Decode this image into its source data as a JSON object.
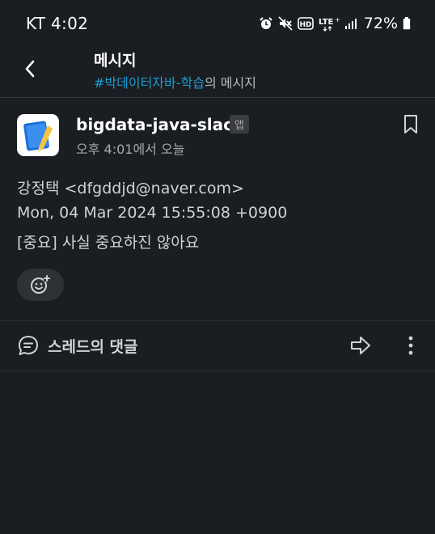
{
  "status_bar": {
    "time": "KT 4:02",
    "battery_percent": "72%",
    "icons": [
      "alarm-icon",
      "mute-icon",
      "hd-icon",
      "lte-icon",
      "signal-icon",
      "battery-icon"
    ]
  },
  "header": {
    "title": "메시지",
    "channel": "#박데이터자바-학습",
    "subtitle_suffix": "의 메시지",
    "back_icon": "chevron-left-icon"
  },
  "message": {
    "sender": "bigdata-java-slack",
    "badge": "앱",
    "time": "오후 4:01에서 오늘",
    "body": [
      "강정택 <dfgddjd@naver.com>",
      "Mon, 04 Mar 2024 15:55:08 +0900",
      "[중요] 사실 중요하진 않아요"
    ],
    "bookmark_icon": "bookmark-icon",
    "reaction_icon": "add-reaction-icon"
  },
  "thread_bar": {
    "label": "스레드의 댓글",
    "thread_icon": "comment-icon",
    "share_icon": "share-arrow-icon",
    "more_icon": "more-vertical-icon"
  },
  "colors": {
    "background": "#1a1d21",
    "link": "#1d9bd1",
    "text": "#d1d2d3"
  }
}
